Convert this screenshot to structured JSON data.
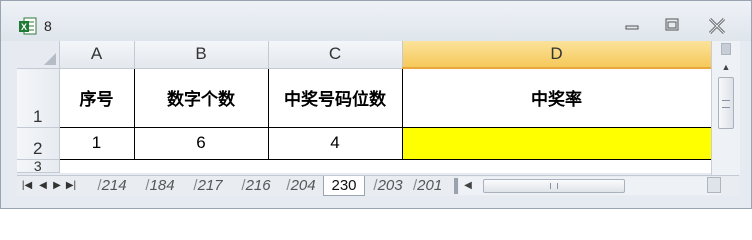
{
  "window": {
    "title": "8",
    "controls": {
      "minimize_icon": "minimize-icon",
      "maximize_icon": "maximize-icon",
      "close_icon": "close-icon"
    }
  },
  "columns": [
    "A",
    "B",
    "C",
    "D"
  ],
  "rows": [
    {
      "header": "1",
      "cells": [
        "序号",
        "数字个数",
        "中奖号码位数",
        "中奖率"
      ]
    },
    {
      "header": "2",
      "cells": [
        "1",
        "6",
        "4",
        ""
      ]
    },
    {
      "header": "3"
    }
  ],
  "colors": {
    "highlight_cell": "#ffff00",
    "selected_column_header": "#f6c95a"
  },
  "sheet_tabs": [
    "214",
    "184",
    "217",
    "216",
    "204",
    "230",
    "203",
    "201"
  ],
  "active_sheet": "230"
}
